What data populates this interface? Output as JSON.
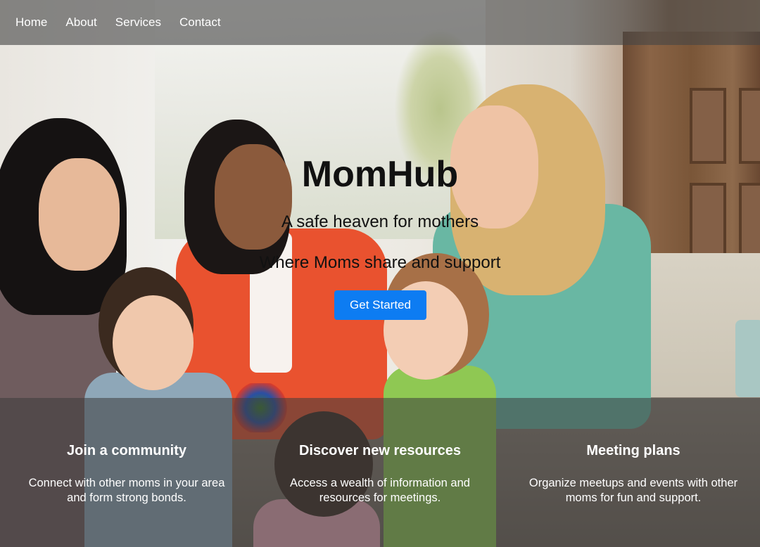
{
  "nav": {
    "items": [
      {
        "label": "Home"
      },
      {
        "label": "About"
      },
      {
        "label": "Services"
      },
      {
        "label": "Contact"
      }
    ]
  },
  "hero": {
    "title": "MomHub",
    "subtitle": "A safe heaven for mothers",
    "tagline": "Where Moms share and support",
    "cta_label": "Get Started"
  },
  "features": [
    {
      "title": "Join a community",
      "description": "Connect with other moms in your area and form strong bonds."
    },
    {
      "title": "Discover new resources",
      "description": "Access a wealth of information and resources for meetings."
    },
    {
      "title": "Meeting plans",
      "description": "Organize meetups and events with other moms for fun and support."
    }
  ],
  "colors": {
    "cta_background": "#0d7cf2",
    "navbar_overlay": "rgba(70,70,70,0.62)",
    "feature_overlay": "rgba(60,60,60,0.55)"
  }
}
